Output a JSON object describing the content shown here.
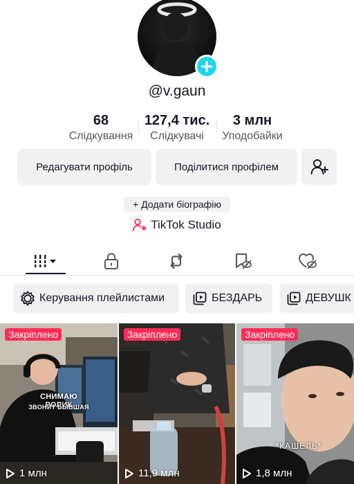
{
  "profile": {
    "username": "@v.gaun",
    "stats": [
      {
        "value": "68",
        "label": "Слідкування"
      },
      {
        "value": "127,4 тис.",
        "label": "Слідкувачі"
      },
      {
        "value": "3 млн",
        "label": "Уподобайки"
      }
    ],
    "edit_button": "Редагувати профіль",
    "share_button": "Поділитися профілем",
    "add_bio": "+ Додати біографію",
    "studio_link": "TikTok Studio"
  },
  "tabs": [
    {
      "name": "videos",
      "icon": "grid-icon",
      "active": true
    },
    {
      "name": "private",
      "icon": "lock-icon",
      "active": false
    },
    {
      "name": "reposts",
      "icon": "repost-icon",
      "active": false
    },
    {
      "name": "favorites",
      "icon": "bookmark-eye-icon",
      "active": false
    },
    {
      "name": "liked",
      "icon": "heart-eye-icon",
      "active": false
    }
  ],
  "playlists": {
    "manage_label": "Керування плейлистами",
    "items": [
      "БЕЗДАРЬ",
      "ДЕВУШК"
    ]
  },
  "videos": [
    {
      "pinned_label": "Закріплено",
      "views": "1 млн",
      "overlay_title": "СНИМАЮ РОЛИК",
      "overlay_subtitle": "ЗВОНИТ БЫВШАЯ"
    },
    {
      "pinned_label": "Закріплено",
      "views": "11,9 млн"
    },
    {
      "pinned_label": "Закріплено",
      "views": "1,8 млн",
      "overlay_caption": "*КАШЕЛЬ*"
    }
  ],
  "colors": {
    "accent_cyan": "#20d5ec",
    "pinned_red": "#fe2c55",
    "studio_icon_red": "#fe2c55",
    "button_bg": "#f1f1f2"
  }
}
